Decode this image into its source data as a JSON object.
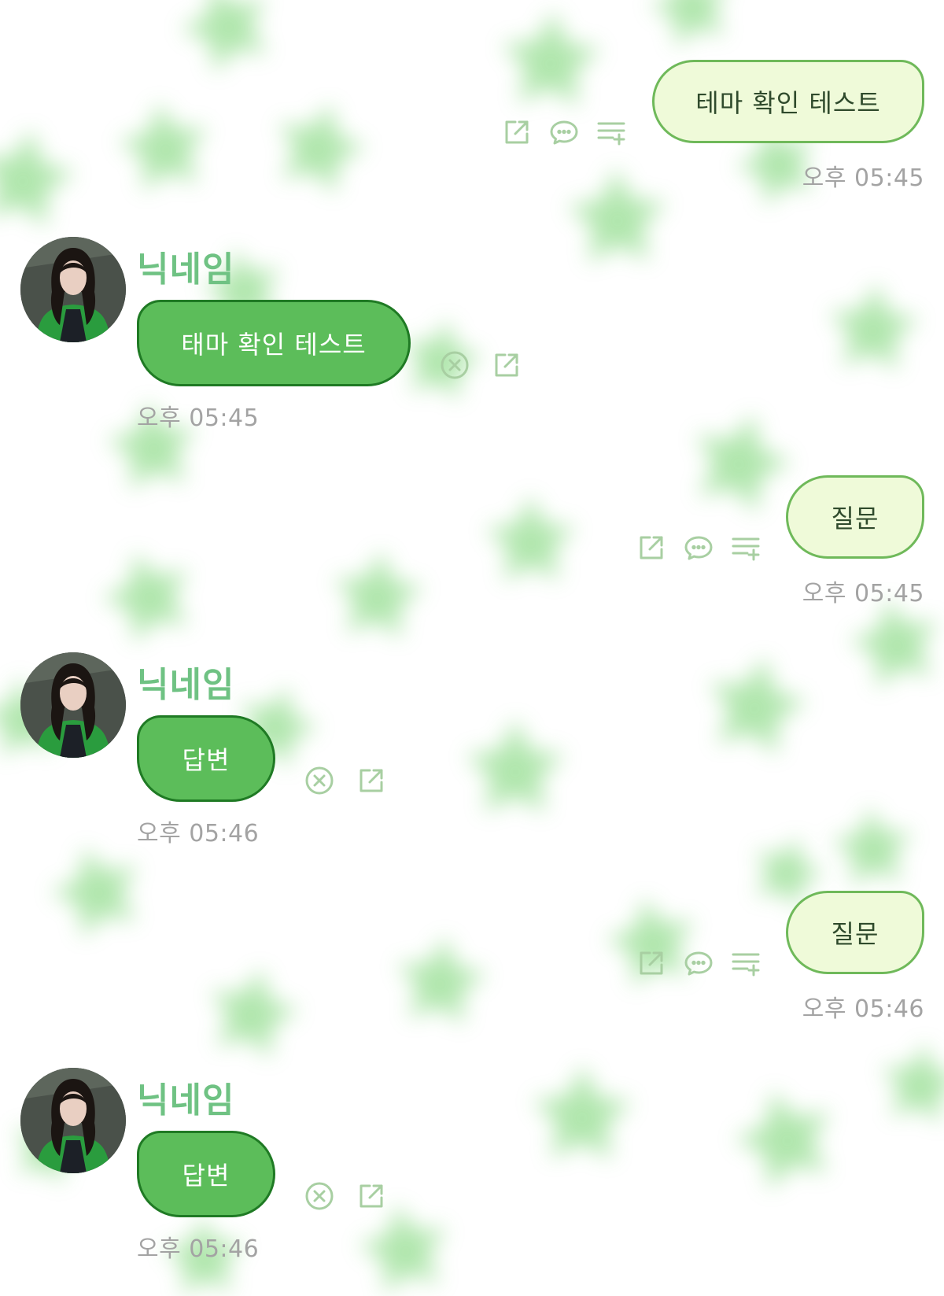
{
  "theme": {
    "accent": "#5cbd5a",
    "accent_dark": "#1f7a24",
    "outgoing_bubble": "#effad9",
    "outgoing_border": "#6fb95a",
    "nickname_color": "#6fc283",
    "background_star": "#8fdc8a"
  },
  "messages": [
    {
      "side": "outgoing",
      "text": "테마 확인 테스트",
      "time": "오후 05:45",
      "actions": [
        "share-icon",
        "reply-icon",
        "add-to-list-icon"
      ]
    },
    {
      "side": "incoming",
      "nickname": "닉네임",
      "text": "태마 확인 테스트",
      "time": "오후 05:45",
      "actions": [
        "delete-icon",
        "share-icon"
      ]
    },
    {
      "side": "outgoing",
      "text": "질문",
      "time": "오후 05:45",
      "actions": [
        "share-icon",
        "reply-icon",
        "add-to-list-icon"
      ]
    },
    {
      "side": "incoming",
      "nickname": "닉네임",
      "text": "답변",
      "time": "오후 05:46",
      "actions": [
        "delete-icon",
        "share-icon"
      ]
    },
    {
      "side": "outgoing",
      "text": "질문",
      "time": "오후 05:46",
      "actions": [
        "share-icon",
        "reply-icon",
        "add-to-list-icon"
      ]
    },
    {
      "side": "incoming",
      "nickname": "닉네임",
      "text": "답변",
      "time": "오후 05:46",
      "actions": [
        "delete-icon",
        "share-icon"
      ]
    }
  ]
}
